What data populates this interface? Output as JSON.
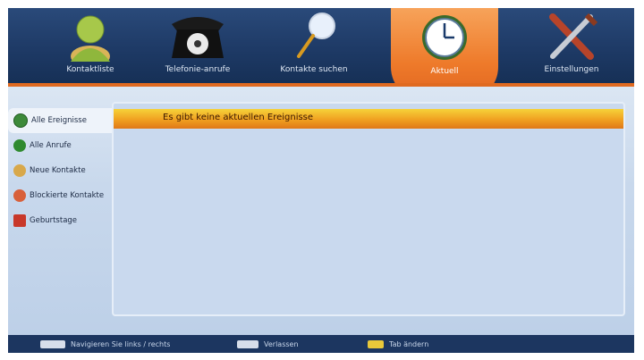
{
  "nav": {
    "items": [
      {
        "label": "Kontaktliste",
        "icon": "person-icon"
      },
      {
        "label": "Telefonie-anrufe",
        "icon": "telephone-icon"
      },
      {
        "label": "Kontakte suchen",
        "icon": "magnifier-icon"
      },
      {
        "label": "Aktuell",
        "icon": "clock-icon",
        "active": true
      },
      {
        "label": "Einstellungen",
        "icon": "tools-icon"
      }
    ]
  },
  "sidebar": {
    "items": [
      {
        "label": "Alle Ereignisse",
        "icon": "clock-icon",
        "selected": true
      },
      {
        "label": "Alle Anrufe",
        "icon": "phone-call-icon"
      },
      {
        "label": "Neue Kontakte",
        "icon": "contacts-icon"
      },
      {
        "label": "Blockierte Kontakte",
        "icon": "blocked-contact-icon"
      },
      {
        "label": "Geburtstage",
        "icon": "cake-icon"
      }
    ]
  },
  "main": {
    "message": "Es gibt keine aktuellen Ereignisse"
  },
  "footer": {
    "hints": [
      {
        "key": "arrow-keys",
        "label": "Navigieren Sie links / rechts"
      },
      {
        "key": "exit-key",
        "label": "Verlassen"
      },
      {
        "key": "yellow-key",
        "label": "Tab ändern"
      }
    ]
  },
  "colors": {
    "accent": "#ee7a2a",
    "topbar": "#1e3a66",
    "panel": "#c9d9ee"
  }
}
